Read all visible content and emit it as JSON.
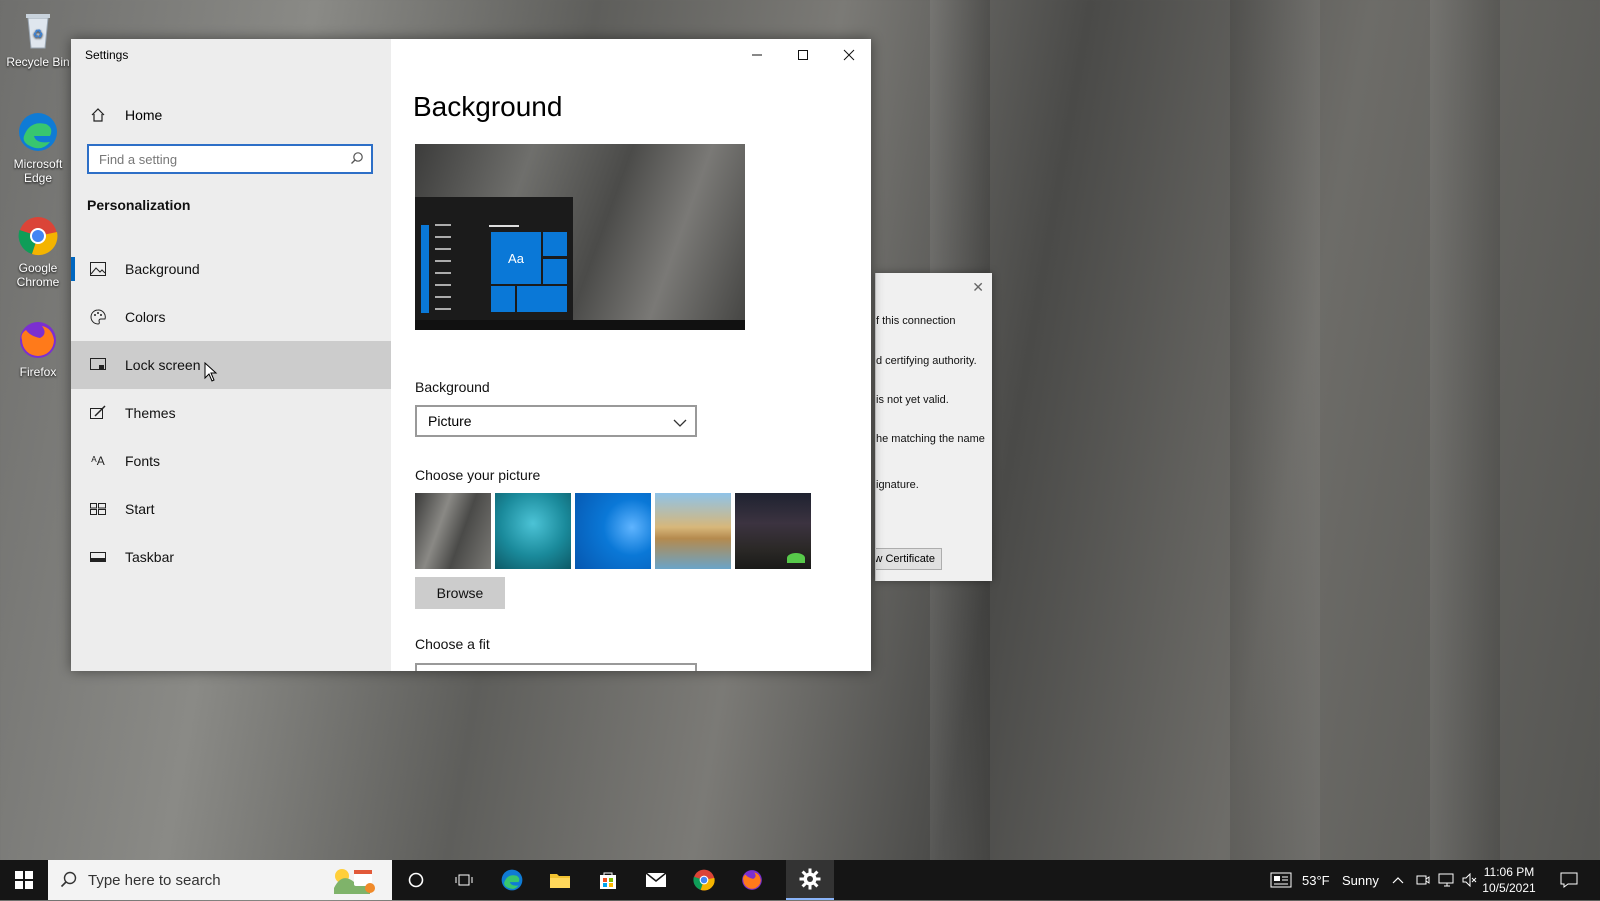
{
  "desktop": {
    "icons": [
      {
        "name": "Recycle Bin",
        "icon": "recycle-bin-icon"
      },
      {
        "name": "Microsoft Edge",
        "icon": "edge-icon"
      },
      {
        "name": "Google Chrome",
        "icon": "chrome-icon"
      },
      {
        "name": "Firefox",
        "icon": "firefox-icon"
      }
    ]
  },
  "settings_window": {
    "title": "Settings",
    "home_label": "Home",
    "search_placeholder": "Find a setting",
    "section_title": "Personalization",
    "nav_items": [
      {
        "label": "Background",
        "icon": "picture-icon",
        "selected": true
      },
      {
        "label": "Colors",
        "icon": "palette-icon"
      },
      {
        "label": "Lock screen",
        "icon": "lock-screen-icon",
        "hovered": true
      },
      {
        "label": "Themes",
        "icon": "brush-icon"
      },
      {
        "label": "Fonts",
        "icon": "fonts-icon"
      },
      {
        "label": "Start",
        "icon": "start-grid-icon"
      },
      {
        "label": "Taskbar",
        "icon": "taskbar-icon"
      }
    ],
    "page_title": "Background",
    "preview_tile_text": "Aa",
    "background_label": "Background",
    "background_value": "Picture",
    "choose_picture_label": "Choose your picture",
    "pictures": [
      "rock cliff",
      "underwater swimmer",
      "windows blue",
      "beach rocks",
      "night sky tent"
    ],
    "browse_label": "Browse",
    "choose_fit_label": "Choose a fit"
  },
  "dialog": {
    "lines": [
      "f this connection",
      "d certifying authority.",
      "is not yet valid.",
      "he matching the name",
      "ignature."
    ],
    "button_label": "w Certificate"
  },
  "taskbar": {
    "search_placeholder": "Type here to search",
    "weather_temp": "53°F",
    "weather_text": "Sunny",
    "time": "11:06 PM",
    "date": "10/5/2021"
  },
  "colors": {
    "accent": "#0067c0",
    "tile_blue": "#0a78d7"
  }
}
